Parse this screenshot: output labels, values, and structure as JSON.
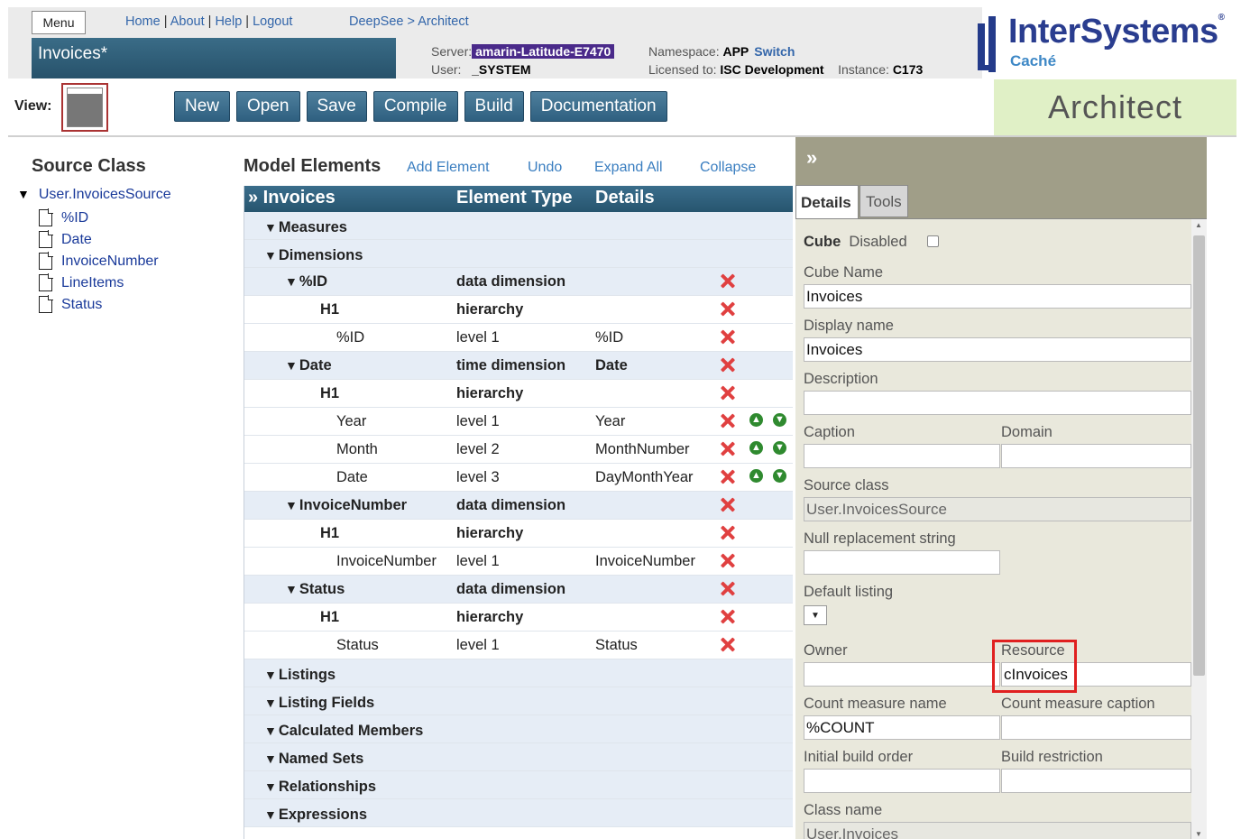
{
  "header": {
    "menu_label": "Menu",
    "links": [
      "Home",
      "About",
      "Help",
      "Logout"
    ],
    "breadcrumb": "DeepSee > Architect",
    "page_title": "Invoices*",
    "server_label": "Server:",
    "server_value": "amarin-Latitude-E7470",
    "user_label": "User:",
    "user_value": "_SYSTEM",
    "namespace_label": "Namespace:",
    "namespace_value": "APP",
    "switch_label": "Switch",
    "licensed_label": "Licensed to:",
    "licensed_value": "ISC Development",
    "instance_label": "Instance:",
    "instance_value": "C173",
    "logo_name": "InterSystems",
    "logo_sub": "Caché",
    "architect_label": "Architect",
    "view_label": "View:"
  },
  "toolbar": {
    "buttons": [
      "New",
      "Open",
      "Save",
      "Compile",
      "Build",
      "Documentation"
    ]
  },
  "source_class": {
    "title": "Source Class",
    "root": "User.InvoicesSource",
    "items": [
      "%ID",
      "Date",
      "InvoiceNumber",
      "LineItems",
      "Status"
    ]
  },
  "model": {
    "title": "Model Elements",
    "links": [
      "Add Element",
      "Undo",
      "Expand All",
      "Collapse"
    ],
    "head": {
      "name": "» Invoices",
      "type": "Element Type",
      "details": "Details"
    },
    "rows": [
      {
        "kind": "section",
        "label": "Measures"
      },
      {
        "kind": "section",
        "label": "Dimensions"
      },
      {
        "kind": "dim",
        "label": "%ID",
        "type": "data dimension",
        "details": "",
        "del": true
      },
      {
        "kind": "hier",
        "label": "H1",
        "type": "hierarchy",
        "details": "",
        "del": true
      },
      {
        "kind": "level",
        "label": "%ID",
        "type": "level 1",
        "details": "%ID",
        "del": true
      },
      {
        "kind": "dim",
        "label": "Date",
        "type": "time dimension",
        "details": "Date",
        "del": true
      },
      {
        "kind": "hier",
        "label": "H1",
        "type": "hierarchy",
        "details": "",
        "del": true
      },
      {
        "kind": "level",
        "label": "Year",
        "type": "level 1",
        "details": "Year",
        "del": true,
        "arrows": true
      },
      {
        "kind": "level",
        "label": "Month",
        "type": "level 2",
        "details": "MonthNumber",
        "del": true,
        "arrows": true
      },
      {
        "kind": "level",
        "label": "Date",
        "type": "level 3",
        "details": "DayMonthYear",
        "del": true,
        "arrows": true
      },
      {
        "kind": "dim",
        "label": "InvoiceNumber",
        "type": "data dimension",
        "details": "",
        "del": true
      },
      {
        "kind": "hier",
        "label": "H1",
        "type": "hierarchy",
        "details": "",
        "del": true
      },
      {
        "kind": "level",
        "label": "InvoiceNumber",
        "type": "level 1",
        "details": "InvoiceNumber",
        "del": true
      },
      {
        "kind": "dim",
        "label": "Status",
        "type": "data dimension",
        "details": "",
        "del": true
      },
      {
        "kind": "hier",
        "label": "H1",
        "type": "hierarchy",
        "details": "",
        "del": true
      },
      {
        "kind": "level",
        "label": "Status",
        "type": "level 1",
        "details": "Status",
        "del": true
      },
      {
        "kind": "section",
        "label": "Listings"
      },
      {
        "kind": "section",
        "label": "Listing Fields"
      },
      {
        "kind": "section",
        "label": "Calculated Members"
      },
      {
        "kind": "section",
        "label": "Named Sets"
      },
      {
        "kind": "section",
        "label": "Relationships"
      },
      {
        "kind": "section",
        "label": "Expressions"
      }
    ]
  },
  "details": {
    "collapse_icon": "»",
    "tabs": [
      "Details",
      "Tools"
    ],
    "cube_label": "Cube",
    "disabled_label": "Disabled",
    "cube_name_label": "Cube Name",
    "cube_name_value": "Invoices",
    "display_name_label": "Display name",
    "display_name_value": "Invoices",
    "description_label": "Description",
    "description_value": "",
    "caption_label": "Caption",
    "caption_value": "",
    "domain_label": "Domain",
    "domain_value": "",
    "source_class_label": "Source class",
    "source_class_value": "User.InvoicesSource",
    "null_label": "Null replacement string",
    "null_value": "",
    "default_listing_label": "Default listing",
    "default_listing_arrow": "▼",
    "owner_label": "Owner",
    "owner_value": "",
    "resource_label": "Resource",
    "resource_value": "cInvoices",
    "count_name_label": "Count measure name",
    "count_name_value": "%COUNT",
    "count_caption_label": "Count measure caption",
    "count_caption_value": "",
    "build_order_label": "Initial build order",
    "build_order_value": "",
    "build_restriction_label": "Build restriction",
    "build_restriction_value": "",
    "class_name_label": "Class name",
    "class_name_value": "User.Invoices"
  },
  "colors": {
    "accent_blue": "#2f6080",
    "server_badge": "#4a2a8a",
    "architect_bg": "#e0f0c6",
    "delete_red": "#e04040",
    "panel_bg": "#e9e8dc"
  }
}
